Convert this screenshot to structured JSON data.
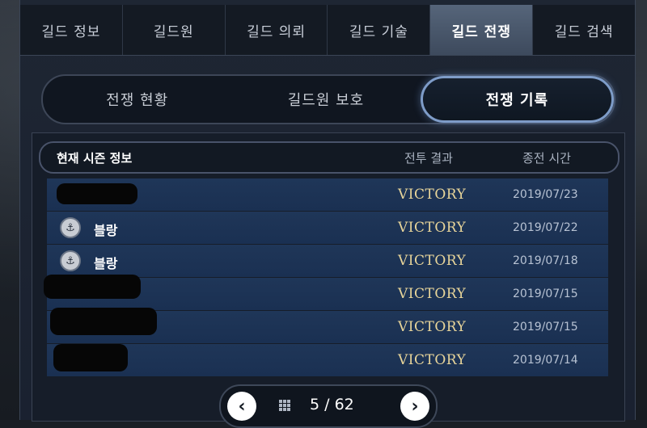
{
  "tabs": [
    {
      "label": "길드 정보"
    },
    {
      "label": "길드원"
    },
    {
      "label": "길드 의뢰"
    },
    {
      "label": "길드 기술"
    },
    {
      "label": "길드 전쟁"
    },
    {
      "label": "길드 검색"
    }
  ],
  "active_tab": "길드 전쟁",
  "subtabs": [
    {
      "label": "전쟁 현황"
    },
    {
      "label": "길드원 보호"
    },
    {
      "label": "전쟁 기록"
    }
  ],
  "active_subtab": "전쟁 기록",
  "table": {
    "headers": {
      "info": "현재 시즌 정보",
      "result": "전투 결과",
      "time": "종전 시간"
    },
    "rows": [
      {
        "name": "",
        "redacted": true,
        "result": "VICTORY",
        "date": "2019/07/23"
      },
      {
        "name": "블랑",
        "redacted": false,
        "result": "VICTORY",
        "date": "2019/07/22"
      },
      {
        "name": "블랑",
        "redacted": false,
        "result": "VICTORY",
        "date": "2019/07/18"
      },
      {
        "name": "",
        "redacted": true,
        "result": "VICTORY",
        "date": "2019/07/15"
      },
      {
        "name": "",
        "redacted": true,
        "result": "VICTORY",
        "date": "2019/07/15"
      },
      {
        "name": "",
        "redacted": true,
        "result": "VICTORY",
        "date": "2019/07/14"
      }
    ]
  },
  "pager": {
    "prev_icon": "chevron-left-icon",
    "next_icon": "chevron-right-icon",
    "grid_icon": "grid-icon",
    "text": "5 / 62"
  },
  "colors": {
    "accent": "#7e9cc8",
    "victory": "#e8d59a",
    "row_bg": "#1f3658"
  }
}
